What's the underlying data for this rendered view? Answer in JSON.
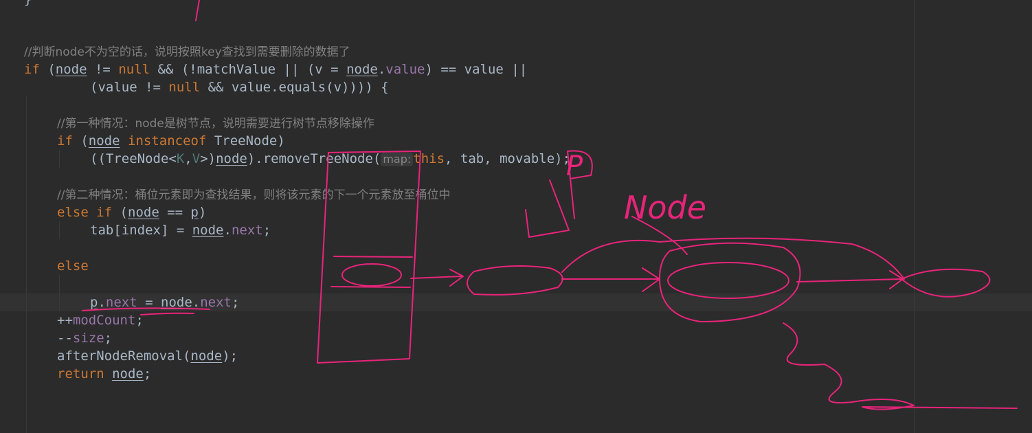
{
  "editor": {
    "lines": {
      "brace": "}",
      "comment_node": "//判断node不为空的话，说明按照key查找到需要删除的数据了",
      "if_kw": "if",
      "if_open": " (",
      "node": "node",
      "ne": " != ",
      "null": "null",
      "and_match": " && (!matchValue || (v = ",
      "dot": ".",
      "value_fld": "value",
      "eq_value": ") == value ||",
      "cont_open": "(value != ",
      "cont_rest": " && value.equals(v)))) {",
      "comment_first": "//第一种情况：node是树节点，说明需要进行树节点移除操作",
      "instanceof": "instanceof",
      "treenode_close": " TreeNode)",
      "cast_open": "((TreeNode<",
      "type_k": "K",
      "comma": ",",
      "type_v": "V",
      "cast_mid": ">)",
      "remove_call": ").removeTreeNode(",
      "hint_map": "map:",
      "this_kw": "this",
      "remove_args": ", tab, movable);",
      "comment_second": "//第二种情况：桶位元素即为查找结果，则将该元素的下一个元素放至桶位中",
      "else_kw": "else",
      "elseif_open": " (",
      "eq_p": " == ",
      "p": "p",
      "close_paren": ")",
      "tab_assign": "tab[index] = ",
      "next_fld": "next",
      "semi": ";",
      "assign": " = ",
      "plusplus": "++",
      "modcount_fld": "modCount",
      "minusminus": "--",
      "size_fld": "size",
      "after_removal": "afterNodeRemoval(",
      "close_semi": ");",
      "return_kw": "return",
      "space": " "
    },
    "annotation_text": {
      "p_label": "P",
      "node_label": "Node"
    },
    "colors": {
      "background": "#2b2b2b",
      "keyword": "#cc7832",
      "comment": "#808080",
      "field": "#9876aa",
      "plain": "#a9b7c6",
      "annotation": "#e8247a"
    }
  }
}
